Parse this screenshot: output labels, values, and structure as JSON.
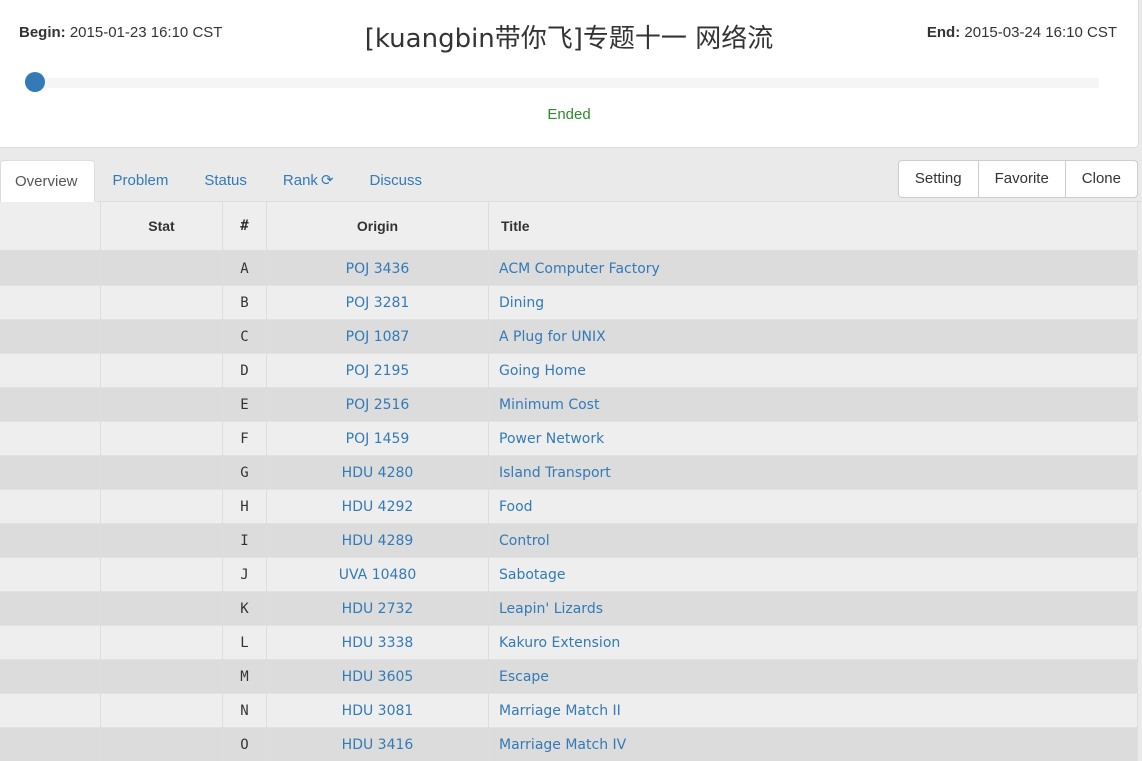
{
  "header": {
    "begin_label": "Begin:",
    "begin_time": "2015-01-23 16:10 CST",
    "end_label": "End:",
    "end_time": "2015-03-24 16:10 CST",
    "title": "[kuangbin带你飞]专题十一 网络流",
    "status": "Ended",
    "progress": 0,
    "accent_color": "#337ab7",
    "status_color": "#2e8b2e"
  },
  "tabs": [
    {
      "label": "Overview",
      "active": true
    },
    {
      "label": "Problem"
    },
    {
      "label": "Status"
    },
    {
      "label": "Rank",
      "icon": "refresh-icon"
    },
    {
      "label": "Discuss"
    }
  ],
  "buttons": {
    "setting": "Setting",
    "favorite": "Favorite",
    "clone": "Clone"
  },
  "table": {
    "columns": {
      "stat": "Stat",
      "num": "#",
      "origin": "Origin",
      "title": "Title"
    },
    "rows": [
      {
        "num": "A",
        "origin": "POJ 3436",
        "title": "ACM Computer Factory"
      },
      {
        "num": "B",
        "origin": "POJ 3281",
        "title": "Dining"
      },
      {
        "num": "C",
        "origin": "POJ 1087",
        "title": "A Plug for UNIX"
      },
      {
        "num": "D",
        "origin": "POJ 2195",
        "title": "Going Home"
      },
      {
        "num": "E",
        "origin": "POJ 2516",
        "title": "Minimum Cost"
      },
      {
        "num": "F",
        "origin": "POJ 1459",
        "title": "Power Network"
      },
      {
        "num": "G",
        "origin": "HDU 4280",
        "title": "Island Transport"
      },
      {
        "num": "H",
        "origin": "HDU 4292",
        "title": "Food"
      },
      {
        "num": "I",
        "origin": "HDU 4289",
        "title": "Control"
      },
      {
        "num": "J",
        "origin": "UVA 10480",
        "title": "Sabotage"
      },
      {
        "num": "K",
        "origin": "HDU 2732",
        "title": "Leapin' Lizards"
      },
      {
        "num": "L",
        "origin": "HDU 3338",
        "title": "Kakuro Extension"
      },
      {
        "num": "M",
        "origin": "HDU 3605",
        "title": "Escape"
      },
      {
        "num": "N",
        "origin": "HDU 3081",
        "title": "Marriage Match II"
      },
      {
        "num": "O",
        "origin": "HDU 3416",
        "title": "Marriage Match IV"
      }
    ]
  }
}
